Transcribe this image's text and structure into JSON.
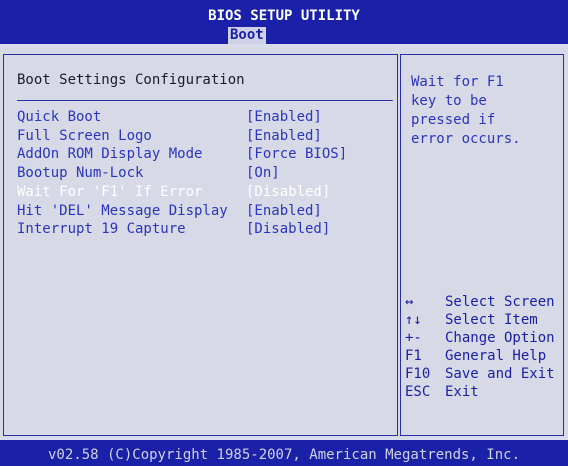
{
  "header": {
    "title": "BIOS SETUP UTILITY",
    "active_tab": "Boot"
  },
  "section_title": "Boot Settings Configuration",
  "settings": [
    {
      "label": "Quick Boot",
      "value": "[Enabled]"
    },
    {
      "label": "Full Screen Logo",
      "value": "[Enabled]"
    },
    {
      "label": "AddOn ROM Display Mode",
      "value": "[Force BIOS]"
    },
    {
      "label": "Bootup Num-Lock",
      "value": "[On]"
    },
    {
      "label": "Wait For 'F1' If Error",
      "value": "[Disabled]",
      "selected": true
    },
    {
      "label": "Hit 'DEL' Message Display",
      "value": "[Enabled]"
    },
    {
      "label": "Interrupt 19 Capture",
      "value": "[Disabled]"
    }
  ],
  "help_text": "Wait for F1\nkey to be\npressed if\nerror occurs.",
  "keys": [
    {
      "key": "↔",
      "desc": "Select Screen"
    },
    {
      "key": "↑↓",
      "desc": "Select Item"
    },
    {
      "key": "+-",
      "desc": "Change Option"
    },
    {
      "key": "F1",
      "desc": "General Help"
    },
    {
      "key": "F10",
      "desc": "Save and Exit"
    },
    {
      "key": "ESC",
      "desc": "Exit"
    }
  ],
  "footer": "v02.58 (C)Copyright 1985-2007, American Megatrends, Inc.",
  "colors": {
    "background": "#1a20a8",
    "panel": "#d7d9e7",
    "item_text": "#2a35c0",
    "selected_text": "#ffffff"
  }
}
